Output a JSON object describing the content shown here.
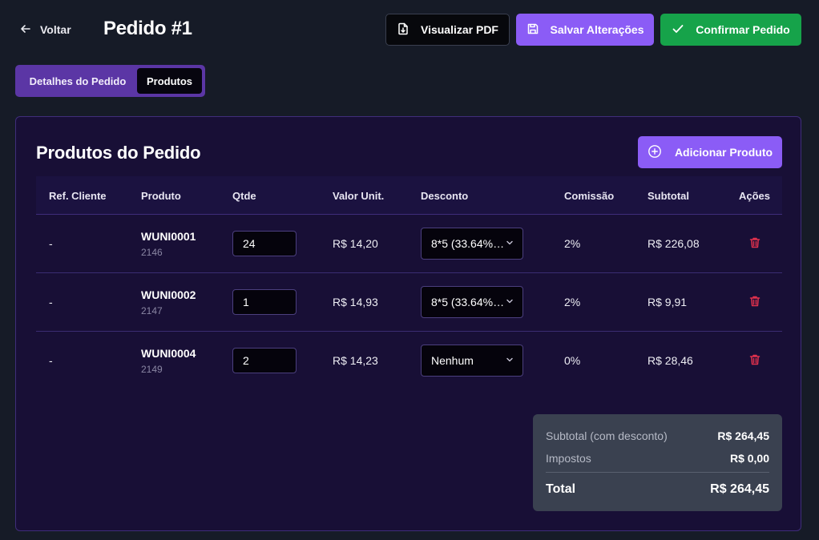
{
  "header": {
    "back_label": "Voltar",
    "title": "Pedido #1",
    "pdf_label": "Visualizar PDF",
    "save_label": "Salvar Alterações",
    "confirm_label": "Confirmar Pedido"
  },
  "tabs": [
    {
      "label": "Detalhes do Pedido",
      "active": false
    },
    {
      "label": "Produtos",
      "active": true
    }
  ],
  "products_section": {
    "title": "Produtos do Pedido",
    "add_button_label": "Adicionar Produto"
  },
  "table": {
    "columns": [
      "Ref. Cliente",
      "Produto",
      "Qtde",
      "Valor Unit.",
      "Desconto",
      "Comissão",
      "Subtotal",
      "Ações"
    ],
    "rows": [
      {
        "ref": "-",
        "product": "WUNI0001",
        "product_id": "2146",
        "qty": "24",
        "unit_price": "R$ 14,20",
        "discount": "8*5 (33.64% ...",
        "commission": "2%",
        "subtotal": "R$ 226,08"
      },
      {
        "ref": "-",
        "product": "WUNI0002",
        "product_id": "2147",
        "qty": "1",
        "unit_price": "R$ 14,93",
        "discount": "8*5 (33.64% ...",
        "commission": "2%",
        "subtotal": "R$ 9,91"
      },
      {
        "ref": "-",
        "product": "WUNI0004",
        "product_id": "2149",
        "qty": "2",
        "unit_price": "R$ 14,23",
        "discount": "Nenhum",
        "commission": "0%",
        "subtotal": "R$ 28,46"
      }
    ]
  },
  "summary": {
    "subtotal_label": "Subtotal (com desconto)",
    "subtotal_value": "R$ 264,45",
    "taxes_label": "Impostos",
    "taxes_value": "R$ 0,00",
    "total_label": "Total",
    "total_value": "R$ 264,45"
  },
  "colors": {
    "background": "#161b27",
    "card": "#180f36",
    "accent": "#8b5cf6",
    "confirm": "#16a34a",
    "danger": "#e0314d"
  },
  "icons": {
    "back": "arrow-left-icon",
    "pdf": "file-download-icon",
    "save": "floppy-disk-icon",
    "confirm": "check-icon",
    "add": "plus-circle-icon",
    "delete": "trash-icon",
    "select": "chevron-down-icon"
  }
}
